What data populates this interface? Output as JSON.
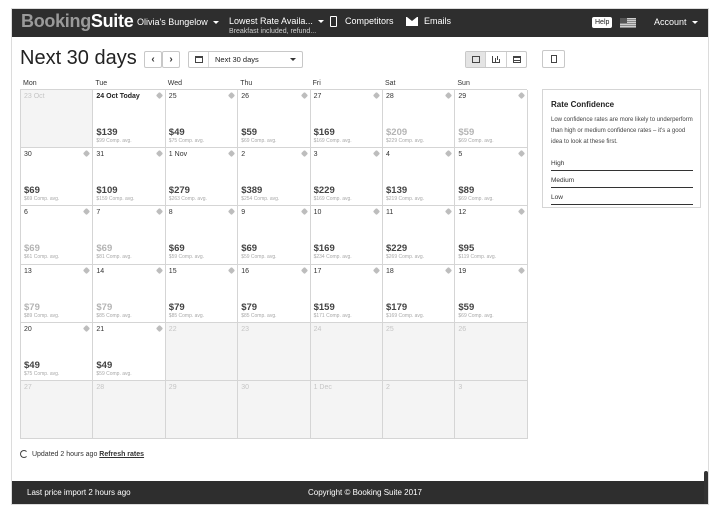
{
  "brand": {
    "part1": "Booking",
    "part2": "Suite"
  },
  "nav": {
    "property": "Olivia's Bungelow",
    "rate": "Lowest Rate Availa...",
    "rate_sub": "Breakfast included, refund...",
    "competitors": "Competitors",
    "emails": "Emails",
    "help": "Help",
    "account": "Account"
  },
  "toolbar": {
    "title": "Next 30 days",
    "prev": "‹",
    "next": "›",
    "range": "Next 30 days"
  },
  "weekdays": [
    "Mon",
    "Tue",
    "Wed",
    "Thu",
    "Fri",
    "Sat",
    "Sun"
  ],
  "calendar": [
    {
      "date": "23 Oct",
      "past": true
    },
    {
      "date": "24 Oct Today",
      "today": true,
      "price": "$139",
      "comp": "$99 Comp. avg.",
      "confidence": "high"
    },
    {
      "date": "25",
      "price": "$49",
      "comp": "$75 Comp. avg.",
      "confidence": "high"
    },
    {
      "date": "26",
      "price": "$59",
      "comp": "$69 Comp. avg.",
      "confidence": "high"
    },
    {
      "date": "27",
      "price": "$169",
      "comp": "$169 Comp. avg.",
      "confidence": "high"
    },
    {
      "date": "28",
      "price": "$209",
      "comp": "$229 Comp. avg.",
      "confidence": "low"
    },
    {
      "date": "29",
      "price": "$59",
      "comp": "$69 Comp. avg.",
      "confidence": "low"
    },
    {
      "date": "30",
      "price": "$69",
      "comp": "$69 Comp. avg.",
      "confidence": "high"
    },
    {
      "date": "31",
      "price": "$109",
      "comp": "$159 Comp. avg.",
      "confidence": "high"
    },
    {
      "date": "1 Nov",
      "price": "$279",
      "comp": "$263 Comp. avg.",
      "confidence": "high"
    },
    {
      "date": "2",
      "price": "$389",
      "comp": "$254 Comp. avg.",
      "confidence": "high"
    },
    {
      "date": "3",
      "price": "$229",
      "comp": "$169 Comp. avg.",
      "confidence": "high"
    },
    {
      "date": "4",
      "price": "$139",
      "comp": "$219 Comp. avg.",
      "confidence": "high"
    },
    {
      "date": "5",
      "price": "$89",
      "comp": "$69 Comp. avg.",
      "confidence": "high"
    },
    {
      "date": "6",
      "price": "$69",
      "comp": "$61 Comp. avg.",
      "confidence": "low"
    },
    {
      "date": "7",
      "price": "$69",
      "comp": "$81 Comp. avg.",
      "confidence": "low"
    },
    {
      "date": "8",
      "price": "$69",
      "comp": "$59 Comp. avg.",
      "confidence": "high"
    },
    {
      "date": "9",
      "price": "$69",
      "comp": "$59 Comp. avg.",
      "confidence": "high"
    },
    {
      "date": "10",
      "price": "$169",
      "comp": "$234 Comp. avg.",
      "confidence": "high"
    },
    {
      "date": "11",
      "price": "$229",
      "comp": "$269 Comp. avg.",
      "confidence": "high"
    },
    {
      "date": "12",
      "price": "$95",
      "comp": "$119 Comp. avg.",
      "confidence": "high"
    },
    {
      "date": "13",
      "price": "$79",
      "comp": "$89 Comp. avg.",
      "confidence": "low"
    },
    {
      "date": "14",
      "price": "$79",
      "comp": "$85 Comp. avg.",
      "confidence": "low"
    },
    {
      "date": "15",
      "price": "$79",
      "comp": "$85 Comp. avg.",
      "confidence": "high"
    },
    {
      "date": "16",
      "price": "$79",
      "comp": "$85 Comp. avg.",
      "confidence": "high"
    },
    {
      "date": "17",
      "price": "$159",
      "comp": "$171 Comp. avg.",
      "confidence": "high"
    },
    {
      "date": "18",
      "price": "$179",
      "comp": "$169 Comp. avg.",
      "confidence": "high"
    },
    {
      "date": "19",
      "price": "$59",
      "comp": "$69 Comp. avg.",
      "confidence": "high"
    },
    {
      "date": "20",
      "price": "$49",
      "comp": "$75 Comp. avg.",
      "confidence": "high"
    },
    {
      "date": "21",
      "price": "$49",
      "comp": "$59 Comp. avg.",
      "confidence": "high"
    },
    {
      "date": "22",
      "past": true
    },
    {
      "date": "23",
      "past": true
    },
    {
      "date": "24",
      "past": true
    },
    {
      "date": "25",
      "past": true
    },
    {
      "date": "26",
      "past": true
    },
    {
      "date": "27",
      "past": true
    },
    {
      "date": "28",
      "past": true
    },
    {
      "date": "29",
      "past": true
    },
    {
      "date": "30",
      "past": true
    },
    {
      "date": "1 Dec",
      "past": true
    },
    {
      "date": "2",
      "past": true
    },
    {
      "date": "3",
      "past": true
    }
  ],
  "status": {
    "updated": "Updated 2 hours ago",
    "refresh": "Refresh rates"
  },
  "rate_confidence": {
    "title": "Rate Confidence",
    "description": "Low confidence rates are more likely to underperform than high or medium confidence rates – it's a good idea to look at these first.",
    "levels": [
      "High",
      "Medium",
      "Low"
    ]
  },
  "footer": {
    "left": "Last price import 2 hours ago",
    "center": "Copyright © Booking Suite 2017"
  }
}
